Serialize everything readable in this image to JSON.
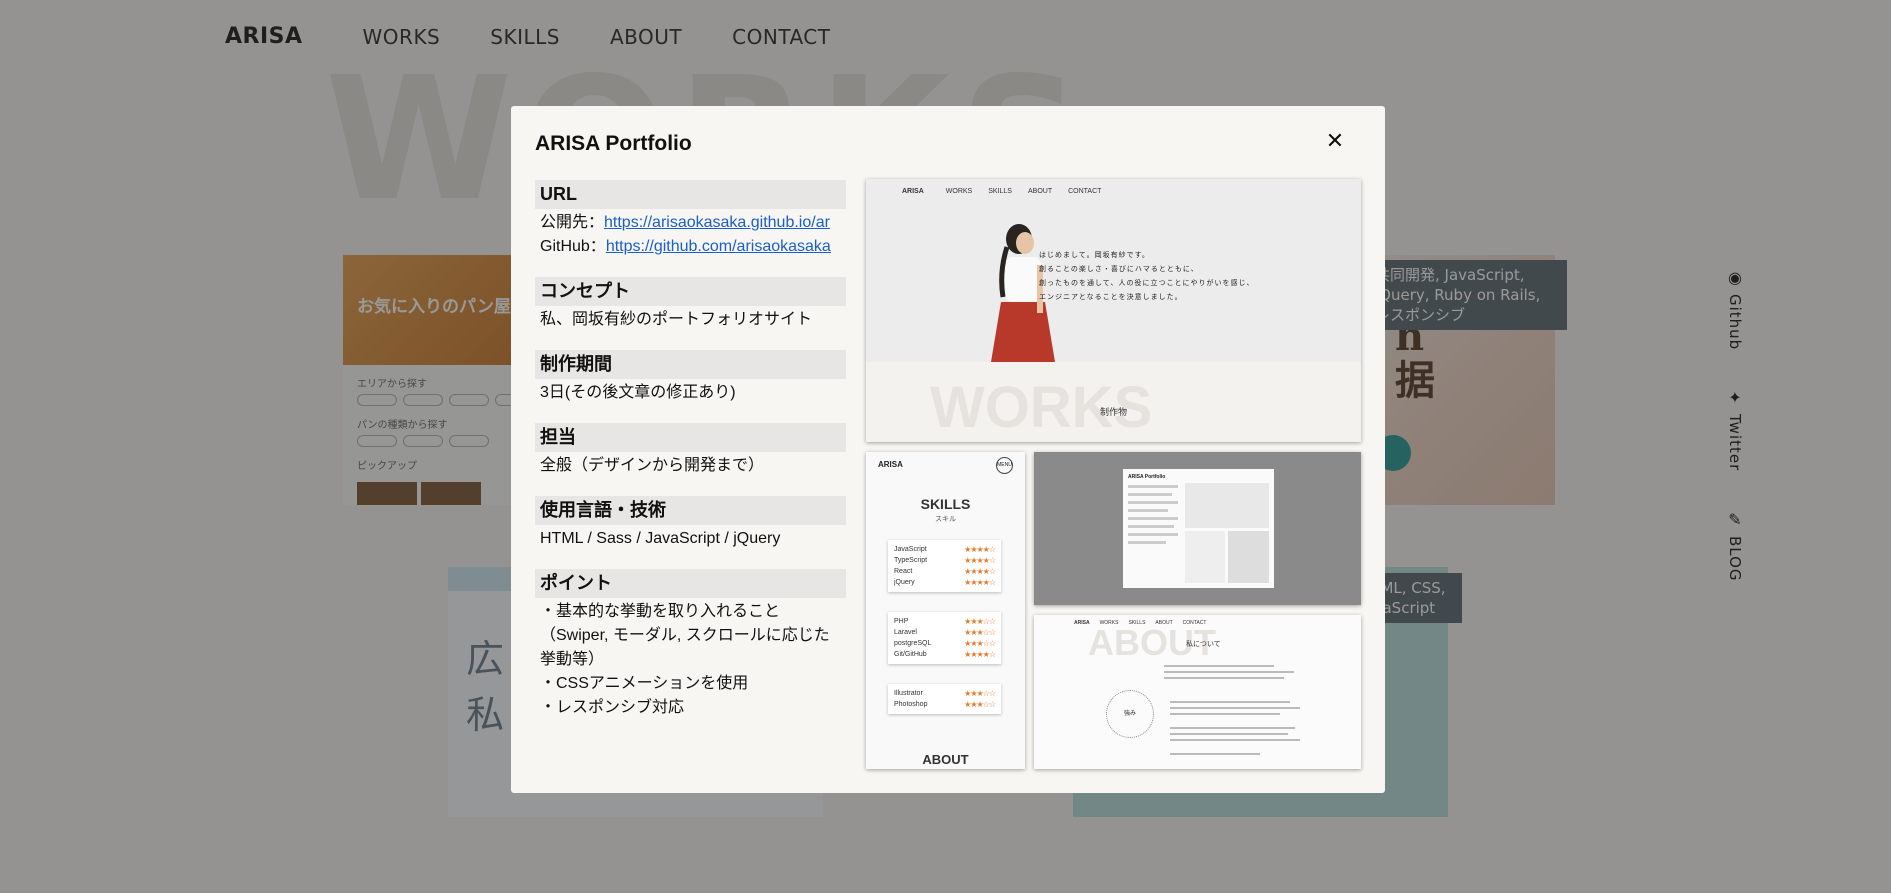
{
  "background": {
    "nav": {
      "brand": "ARISA",
      "items": [
        "WORKS",
        "SKILLS",
        "ABOUT",
        "CONTACT"
      ]
    },
    "section_title": "WORKS",
    "cards": {
      "bread_hero": "お気に入りのパン屋さんを見つける、つながる",
      "bread_area_label": "エリアから探す",
      "bread_type_label": "パンの種類から探す",
      "bread_pickup_label": "ピックアップ",
      "right_tag": "共同開発, JavaScript, jQuery, Ruby on Rails, レスポンシブ",
      "blue_text": "広\n私",
      "teal_tag": "HTML, CSS, JavaScript"
    },
    "side_links": [
      {
        "label": "Github",
        "icon": "github-icon"
      },
      {
        "label": "Twitter",
        "icon": "twitter-icon"
      },
      {
        "label": "BLOG",
        "icon": "blog-icon"
      }
    ]
  },
  "modal": {
    "title": "ARISA Portfolio",
    "close_symbol": "✕",
    "sections": {
      "url": {
        "heading": "URL",
        "public_prefix": "公開先：",
        "public_link": "https://arisaokasaka.github.io/ar",
        "github_prefix": "GitHub：",
        "github_link": "https://github.com/arisaokasaka"
      },
      "concept": {
        "heading": "コンセプト",
        "body": "私、岡坂有紗のポートフォリオサイト"
      },
      "period": {
        "heading": "制作期間",
        "body": "3日(その後文章の修正あり)"
      },
      "role": {
        "heading": "担当",
        "body": "全般（デザインから開発まで）"
      },
      "tech": {
        "heading": "使用言語・技術",
        "body": "HTML / Sass / JavaScript / jQuery"
      },
      "points": {
        "heading": "ポイント",
        "lines": [
          "・基本的な挙動を取り入れること",
          "（Swiper, モーダル, スクロールに応じた挙動等）",
          "・CSSアニメーションを使用",
          "・レスポンシブ対応"
        ]
      }
    },
    "screenshots": {
      "main": {
        "nav": [
          "ARISA",
          "WORKS",
          "SKILLS",
          "ABOUT",
          "CONTACT"
        ],
        "intro_lines": [
          "はじめまして。岡坂有紗です。",
          "創ることの楽しさ・喜びにハマるとともに、",
          "創ったものを通して、人の役に立つことにやりがいを感じ、",
          "エンジニアとなることを決意しました。"
        ],
        "big": "WORKS",
        "sub": "制作物"
      },
      "skills": {
        "logo": "ARISA",
        "menu": "MENU",
        "heading": "SKILLS",
        "sub": "スキル",
        "groups": [
          [
            {
              "name": "JavaScript",
              "stars": "★★★★☆"
            },
            {
              "name": "TypeScript",
              "stars": "★★★★☆"
            },
            {
              "name": "React",
              "stars": "★★★★☆"
            },
            {
              "name": "jQuery",
              "stars": "★★★★☆"
            }
          ],
          [
            {
              "name": "PHP",
              "stars": "★★★☆☆"
            },
            {
              "name": "Laravel",
              "stars": "★★★☆☆"
            },
            {
              "name": "postgreSQL",
              "stars": "★★★☆☆"
            },
            {
              "name": "Git/GitHub",
              "stars": "★★★★☆"
            }
          ],
          [
            {
              "name": "Illustrator",
              "stars": "★★★☆☆"
            },
            {
              "name": "Photoshop",
              "stars": "★★★☆☆"
            }
          ]
        ],
        "footer": "ABOUT"
      },
      "modal_preview": {
        "title": "ARISA Portfolio"
      },
      "about": {
        "nav": [
          "ARISA",
          "WORKS",
          "SKILLS",
          "ABOUT",
          "CONTACT"
        ],
        "big": "ABOUT",
        "sub": "私について",
        "circle": "強み"
      }
    }
  }
}
